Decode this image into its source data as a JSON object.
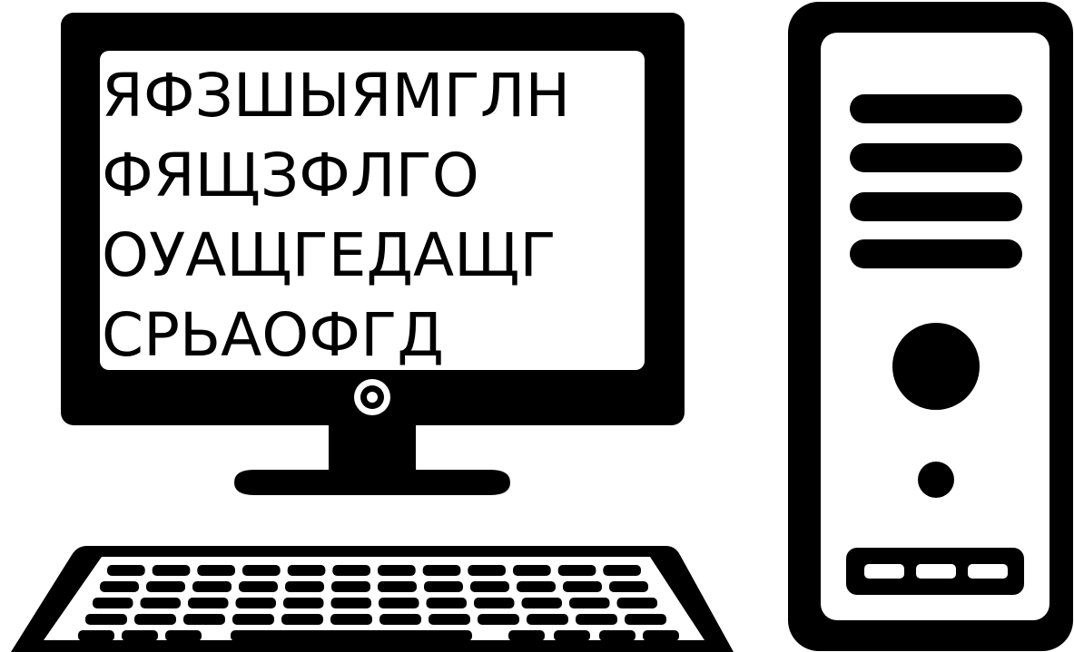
{
  "screen": {
    "lines": [
      "ЯФЗШЫЯМГЛН",
      "ФЯЩЗФЛГО",
      "ОУАЩГЕДАЩГ",
      "СРЬАОФГД"
    ]
  },
  "colors": {
    "ink": "#000000",
    "paper": "#ffffff"
  },
  "icons": {
    "monitor": "monitor-icon",
    "tower": "computer-tower-icon",
    "keyboard": "keyboard-icon"
  }
}
